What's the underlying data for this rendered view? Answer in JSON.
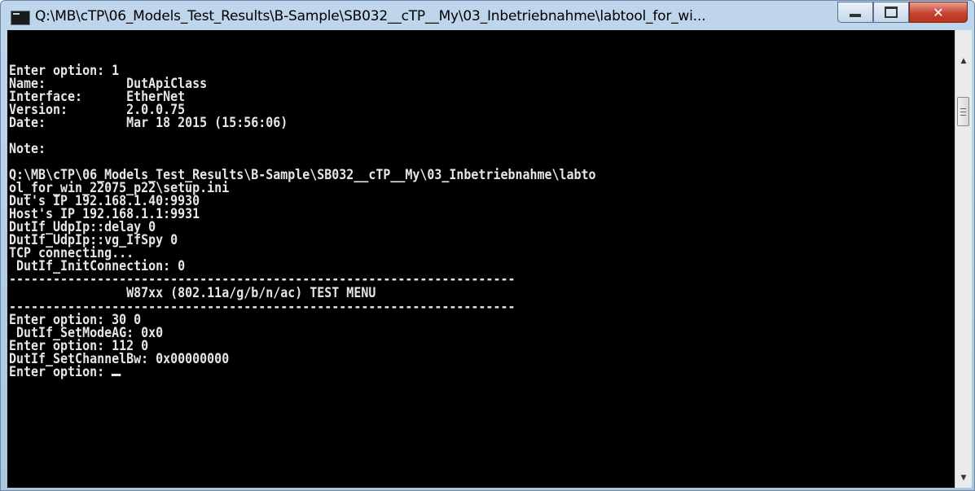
{
  "window": {
    "title": "Q:\\MB\\cTP\\06_Models_Test_Results\\B-Sample\\SB032__cTP__My\\03_Inbetriebnahme\\labtool_for_wi...",
    "controls": {
      "minimize": "minimize-icon",
      "maximize": "maximize-icon",
      "close": "close-icon"
    }
  },
  "console": {
    "lines": [
      "Enter option: 1",
      "Name:           DutApiClass",
      "Interface:      EtherNet",
      "Version:        2.0.0.75",
      "Date:           Mar 18 2015 (15:56:06)",
      "",
      "Note:",
      "",
      "Q:\\MB\\cTP\\06_Models_Test_Results\\B-Sample\\SB032__cTP__My\\03_Inbetriebnahme\\labto",
      "ol_for_win_22075_p22\\setup.ini",
      "Dut's IP 192.168.1.40:9930",
      "Host's IP 192.168.1.1:9931",
      "DutIf_UdpIp::delay 0",
      "DutIf_UdpIp::vg_IfSpy 0",
      "TCP connecting...",
      " DutIf_InitConnection: 0",
      "---------------------------------------------------------------------",
      "                W87xx (802.11a/g/b/n/ac) TEST MENU",
      "---------------------------------------------------------------------",
      "Enter option: 30 0",
      " DutIf_SetModeAG: 0x0",
      "Enter option: 112 0",
      "DutIf_SetChannelBw: 0x00000000",
      "Enter option: "
    ]
  }
}
